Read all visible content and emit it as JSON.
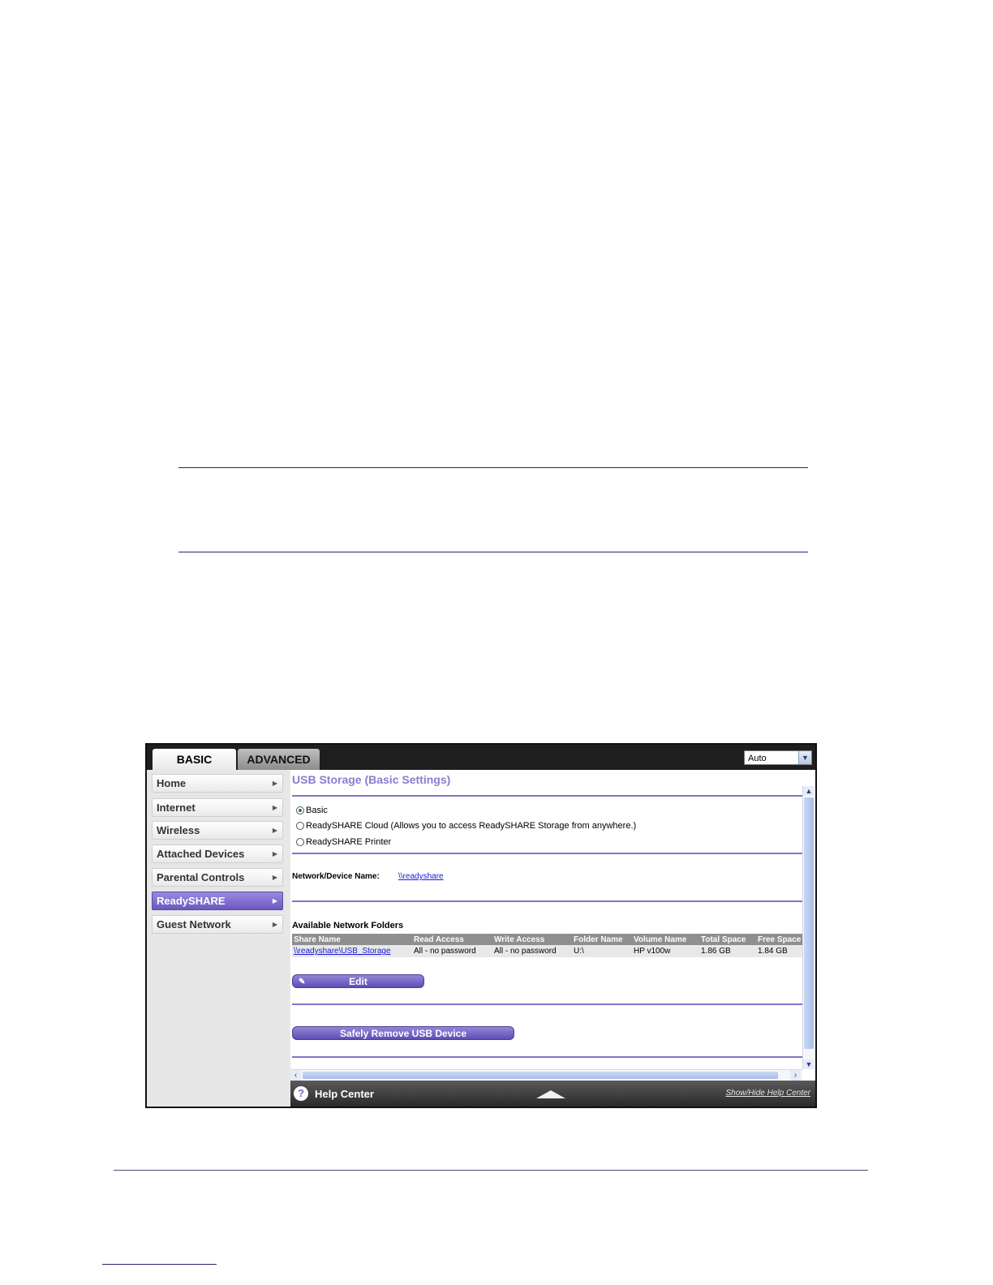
{
  "tabs": {
    "basic": "BASIC",
    "advanced": "ADVANCED"
  },
  "language": {
    "selected": "Auto"
  },
  "sidebar": {
    "items": [
      {
        "label": "Home"
      },
      {
        "label": "Internet"
      },
      {
        "label": "Wireless"
      },
      {
        "label": "Attached Devices"
      },
      {
        "label": "Parental Controls"
      },
      {
        "label": "ReadySHARE"
      },
      {
        "label": "Guest Network"
      }
    ],
    "active": "ReadySHARE"
  },
  "main": {
    "title": "USB Storage (Basic Settings)",
    "options": {
      "basic": "Basic",
      "cloud": "ReadySHARE Cloud (Allows you to access ReadySHARE Storage from anywhere.)",
      "printer": "ReadySHARE Printer",
      "selected": "Basic"
    },
    "device_name_label": "Network/Device Name:",
    "device_name_value": "\\\\readyshare",
    "folders_label": "Available Network Folders",
    "table": {
      "headers": [
        "Share Name",
        "Read Access",
        "Write Access",
        "Folder Name",
        "Volume Name",
        "Total Space",
        "Free Space"
      ],
      "rows": [
        [
          "\\\\readyshare\\USB_Storage",
          "All - no password",
          "All - no password",
          "U:\\",
          "HP v100w",
          "1.86 GB",
          "1.84 GB"
        ]
      ]
    },
    "edit_button": "Edit",
    "remove_button": "Safely Remove USB Device"
  },
  "help": {
    "label": "Help Center",
    "toggle_link": "Show/Hide Help Center"
  },
  "colors": {
    "accent": "#8174c8",
    "active_nav": "#6b58c0",
    "link": "#1a1ad0"
  }
}
